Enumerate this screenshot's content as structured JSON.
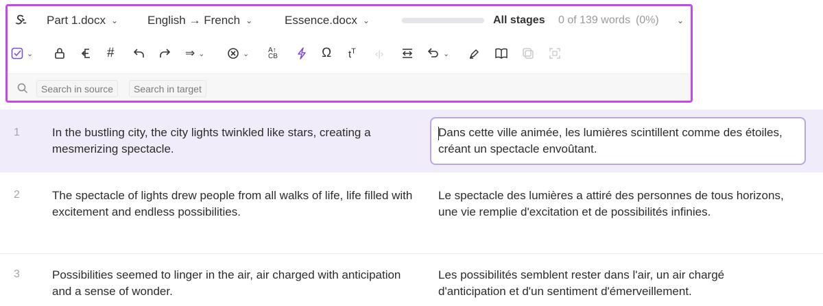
{
  "header": {
    "file_dropdown": "Part 1.docx",
    "language_dropdown": "English → French",
    "reference_dropdown": "Essence.docx",
    "stages_label": "All stages",
    "word_count": "0 of 139 words",
    "word_percent": "(0%)",
    "progress_fraction": 0
  },
  "toolbar": {
    "tools": [
      {
        "name": "confirm-segment-icon",
        "glyph": "☑"
      },
      {
        "name": "lock-icon",
        "glyph": "🔒"
      },
      {
        "name": "copy-source-icon",
        "glyph": "↤"
      },
      {
        "name": "hash-icon",
        "glyph": "#"
      },
      {
        "name": "undo-icon",
        "glyph": "↶"
      },
      {
        "name": "redo-icon",
        "glyph": "↷"
      },
      {
        "name": "insert-tags-icon",
        "glyph": "⇒"
      },
      {
        "name": "clear-target-icon",
        "glyph": "⊗"
      },
      {
        "name": "change-case-icon",
        "glyph": "Aa"
      },
      {
        "name": "lightning-icon",
        "glyph": "⚡"
      },
      {
        "name": "omega-icon",
        "glyph": "Ω"
      },
      {
        "name": "text-format-icon",
        "glyph": "tT"
      },
      {
        "name": "tag-brackets-icon",
        "glyph": "‹›"
      },
      {
        "name": "join-segments-icon",
        "glyph": "⇄"
      },
      {
        "name": "revert-icon",
        "glyph": "↰"
      },
      {
        "name": "pen-icon",
        "glyph": "✒"
      },
      {
        "name": "book-icon",
        "glyph": "📖"
      },
      {
        "name": "copy-icon",
        "glyph": "⧉"
      },
      {
        "name": "expand-icon",
        "glyph": "⛶"
      }
    ]
  },
  "search": {
    "source_placeholder": "Search in source",
    "target_placeholder": "Search in target"
  },
  "segments": [
    {
      "number": "1",
      "source": "In the bustling city, the city lights twinkled like stars, creating a mesmerizing spectacle.",
      "target": "Dans cette ville animée, les lumières scintillent comme des étoiles, créant un spectacle envoûtant."
    },
    {
      "number": "2",
      "source": "The spectacle of lights drew people from all walks of life, life filled with excitement and endless possibilities.",
      "target": "Le spectacle des lumières a attiré des personnes de tous horizons, une vie remplie d'excitation et de possibilités infinies."
    },
    {
      "number": "3",
      "source": "Possibilities seemed to linger in the air, air charged with anticipation and a sense of wonder.",
      "target": "Les possibilités semblent rester dans l'air, un air chargé d'anticipation et d'un sentiment d'émerveillement."
    }
  ],
  "colors": {
    "accent": "#c14bea",
    "active_segment_bg": "#f0ecfa",
    "editor_border": "#b9a6e6"
  }
}
